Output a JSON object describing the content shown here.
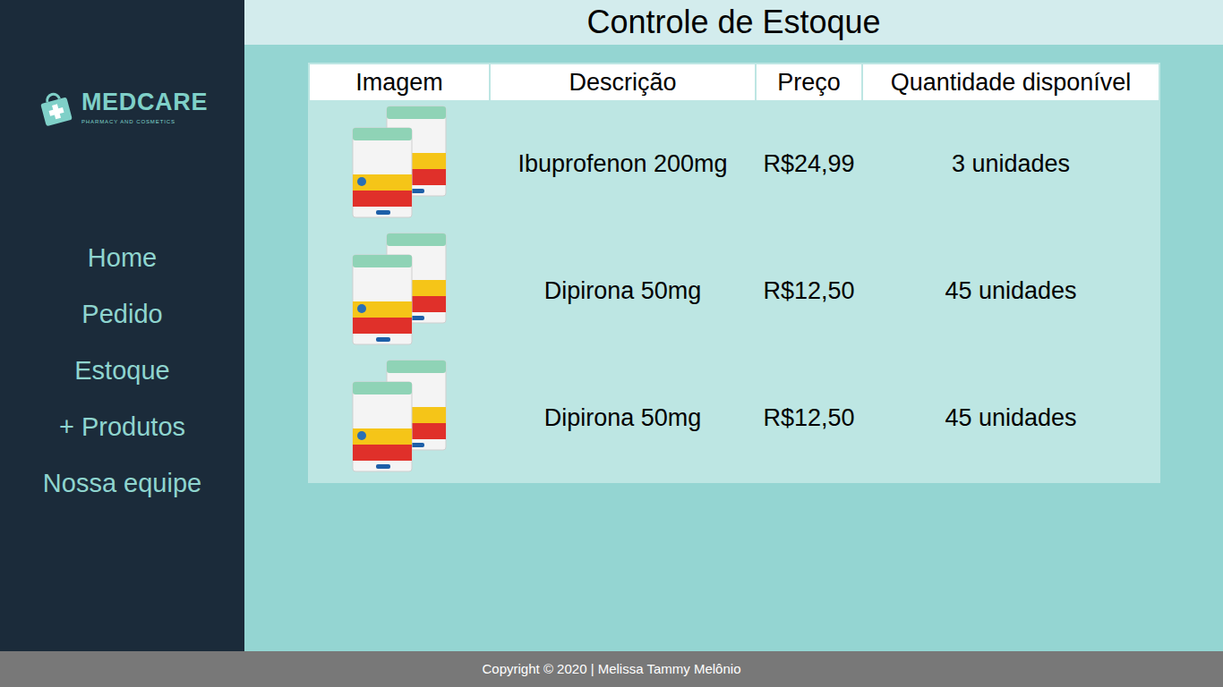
{
  "window": {
    "title": "Controle de Estoque"
  },
  "brand": {
    "name": "MEDCARE",
    "tagline": "PHARMACY AND COSMETICS"
  },
  "sidebar": {
    "items": [
      {
        "label": "Home",
        "selected": false
      },
      {
        "label": "Pedido",
        "selected": false
      },
      {
        "label": "Estoque",
        "selected": false
      },
      {
        "label": "+ Produtos",
        "selected": false
      },
      {
        "label": "Nossa equipe",
        "selected": false
      }
    ]
  },
  "table": {
    "columns": [
      "Imagem",
      "Descrição",
      "Preço",
      "Quantidade disponível"
    ],
    "rows": [
      {
        "description": "Ibuprofenon 200mg",
        "price": "R$24,99",
        "quantity": "3 unidades"
      },
      {
        "description": "Dipirona 50mg",
        "price": "R$12,50",
        "quantity": "45 unidades"
      },
      {
        "description": "Dipirona 50mg",
        "price": "R$12,50",
        "quantity": "45 unidades"
      }
    ]
  },
  "status_bar": {
    "text": "Copyright © 2020 | Melissa Tammy Melônio"
  }
}
